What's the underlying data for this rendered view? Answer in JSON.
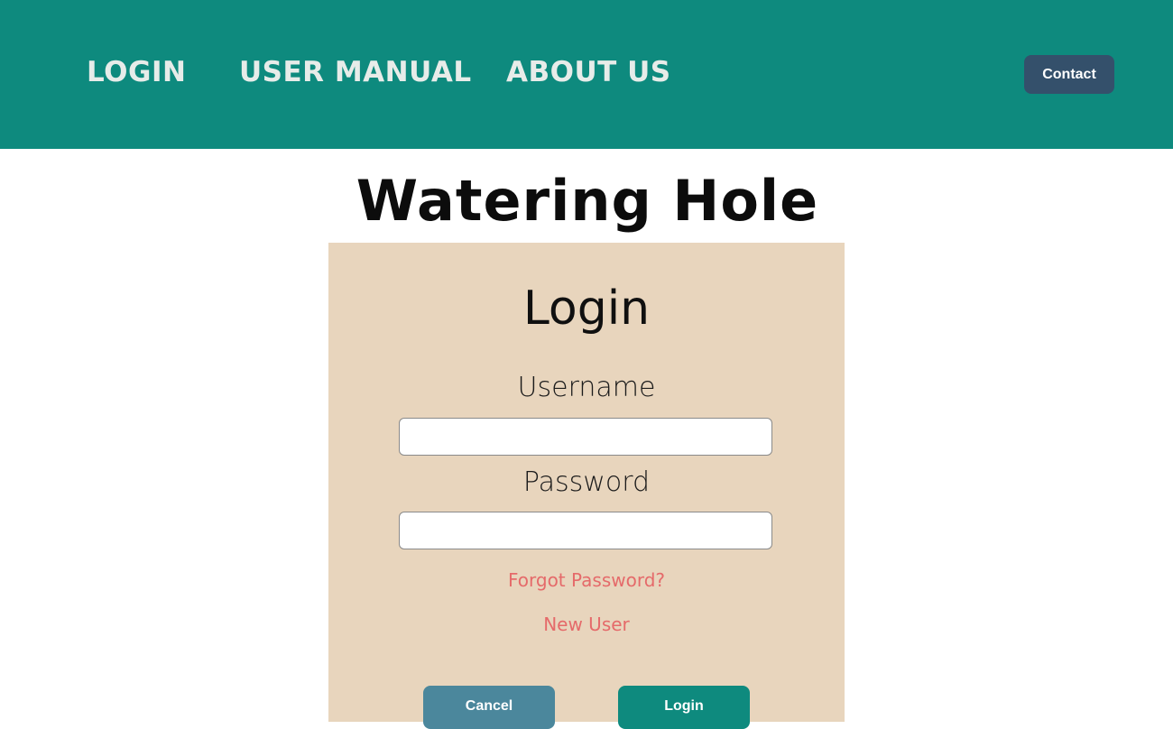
{
  "header": {
    "nav": [
      "LOGIN",
      "USER MANUAL",
      "ABOUT US"
    ],
    "contact_label": "Contact"
  },
  "logo": {
    "text": "Watering Hole",
    "icons": [
      "cocktail-glass-icon",
      "cheers-glasses-icon",
      "beer-mug-icon"
    ]
  },
  "login_form": {
    "title": "Login",
    "username_label": "Username",
    "username_value": "",
    "password_label": "Password",
    "password_value": "",
    "forgot_password": "Forgot Password?",
    "new_user": "New User",
    "cancel_label": "Cancel",
    "login_label": "Login"
  },
  "colors": {
    "header_bg": "#0e8a7e",
    "contact_btn": "#34506b",
    "panel_bg": "#e8d5bd",
    "link": "#e56a6a",
    "cancel_btn": "#4b879c",
    "login_btn": "#0e8a7e"
  }
}
